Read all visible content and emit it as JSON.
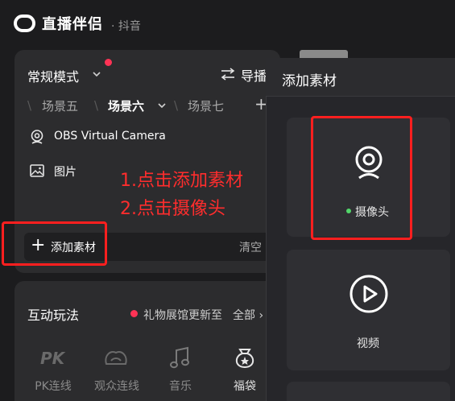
{
  "header": {
    "app_name": "直播伴侣",
    "platform": "· 抖音"
  },
  "top_bar": {
    "mode_label": "常规模式",
    "guide_label": "导播"
  },
  "scenes": {
    "items": [
      "场景五",
      "场景六",
      "场景七"
    ],
    "active": "场景六",
    "add": "+"
  },
  "sources": [
    {
      "label": "OBS Virtual Camera",
      "icon": "webcam-icon"
    },
    {
      "label": "图片",
      "icon": "image-icon"
    }
  ],
  "annotation": {
    "line1": "1.点击添加素材",
    "line2": "2.点击摄像头",
    "color": "#ff2d2d"
  },
  "add_bar": {
    "add_label": "添加素材",
    "add_symbol": "+",
    "clear_label": "清空"
  },
  "interactive": {
    "title": "互动玩法",
    "notice": "礼物展馆更新至",
    "all_label": "全部 ›",
    "tools": [
      {
        "label": "PK连线",
        "icon": "pk-icon"
      },
      {
        "label": "观众连线",
        "icon": "audience-link-icon"
      },
      {
        "label": "音乐",
        "icon": "music-icon"
      },
      {
        "label": "福袋",
        "icon": "lucky-bag-icon"
      }
    ]
  },
  "dialog": {
    "title": "添加素材",
    "cards": [
      {
        "label": "摄像头",
        "icon": "camera-icon",
        "status": "online"
      },
      {
        "label": "视频",
        "icon": "play-icon"
      }
    ]
  },
  "colors": {
    "accent_red": "#ff3355",
    "highlight_box": "#ff1f1f",
    "status_green": "#52d66a"
  }
}
